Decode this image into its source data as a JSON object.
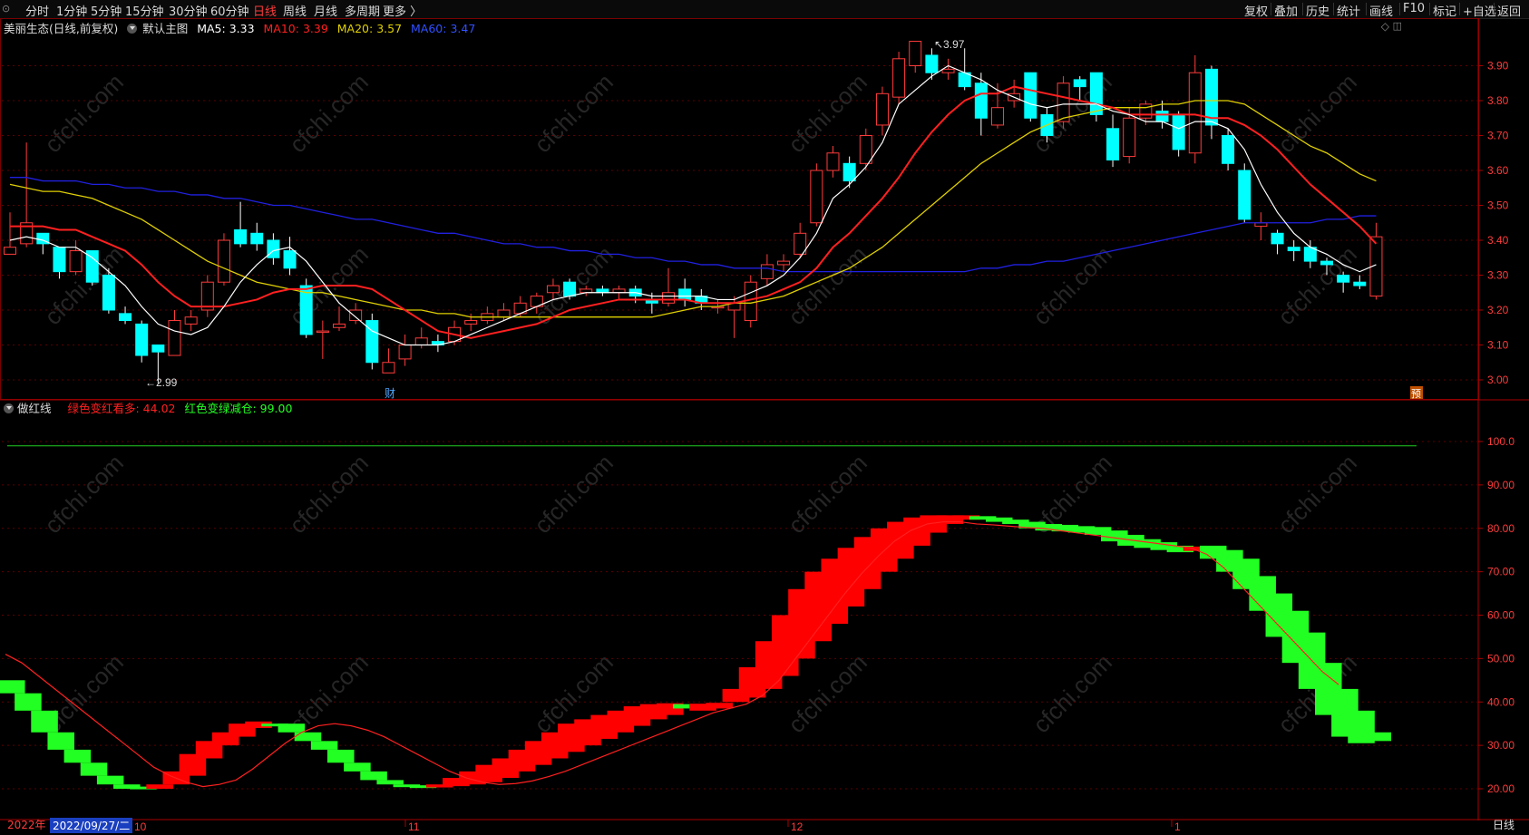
{
  "toolbar": {
    "left": [
      "分时",
      "1分钟",
      "5分钟",
      "15分钟",
      "30分钟",
      "60分钟",
      "日线",
      "周线",
      "月线",
      "多周期",
      "更多 〉"
    ],
    "active": "日线",
    "right": [
      "复权",
      "叠加",
      "历史",
      "统计",
      "画线",
      "F10",
      "标记",
      "+自选",
      "返回"
    ]
  },
  "main": {
    "stock_title": "美丽生态(日线,前复权)",
    "template": "默认主图",
    "ma5": "MA5: 3.33",
    "ma10": "MA10: 3.39",
    "ma20": "MA20: 3.57",
    "ma60": "MA60: 3.47",
    "high_label": "3.97",
    "low_label": "2.99",
    "cai_marker": "财",
    "yu_marker": "预",
    "price_ticks": [
      "3.90",
      "3.80",
      "3.70",
      "3.60",
      "3.50",
      "3.40",
      "3.30",
      "3.20",
      "3.10",
      "3.00"
    ]
  },
  "indicator": {
    "name": "做红线",
    "label1": "绿色变红看多: 44.02",
    "label2": "红色变绿减仓: 99.00",
    "ticks": [
      "100.0",
      "90.00",
      "80.00",
      "70.00",
      "60.00",
      "50.00",
      "40.00",
      "30.00",
      "20.00"
    ]
  },
  "xaxis": {
    "year": "2022年",
    "cursor_date": "2022/09/27/二",
    "months": [
      "10",
      "11",
      "12",
      "1"
    ],
    "period_label": "日线"
  },
  "watermark": "cfchi.com",
  "colors": {
    "up": "#ff3b3b",
    "down": "#00ffff",
    "ma5": "#ffffff",
    "ma10": "#ff2020",
    "ma20": "#e0d000",
    "ma60": "#2020e0",
    "ind_red": "#ff0000",
    "ind_green": "#22ff22"
  },
  "chart_data": {
    "type": "candlestick",
    "candles": [
      [
        3.36,
        3.38,
        3.48,
        3.36
      ],
      [
        3.39,
        3.45,
        3.68,
        3.38
      ],
      [
        3.42,
        3.39,
        3.42,
        3.36
      ],
      [
        3.38,
        3.31,
        3.38,
        3.29
      ],
      [
        3.31,
        3.37,
        3.4,
        3.3
      ],
      [
        3.37,
        3.28,
        3.37,
        3.27
      ],
      [
        3.3,
        3.2,
        3.32,
        3.19
      ],
      [
        3.19,
        3.17,
        3.21,
        3.16
      ],
      [
        3.16,
        3.07,
        3.17,
        3.05
      ],
      [
        3.1,
        3.08,
        3.1,
        2.99
      ],
      [
        3.07,
        3.17,
        3.2,
        3.07
      ],
      [
        3.16,
        3.18,
        3.2,
        3.14
      ],
      [
        3.2,
        3.28,
        3.3,
        3.18
      ],
      [
        3.28,
        3.4,
        3.42,
        3.27
      ],
      [
        3.43,
        3.39,
        3.51,
        3.38
      ],
      [
        3.42,
        3.39,
        3.45,
        3.37
      ],
      [
        3.4,
        3.35,
        3.42,
        3.33
      ],
      [
        3.37,
        3.32,
        3.41,
        3.3
      ],
      [
        3.27,
        3.13,
        3.29,
        3.12
      ],
      [
        3.14,
        3.14,
        3.17,
        3.06
      ],
      [
        3.15,
        3.16,
        3.21,
        3.14
      ],
      [
        3.17,
        3.2,
        3.22,
        3.16
      ],
      [
        3.17,
        3.05,
        3.19,
        3.03
      ],
      [
        3.02,
        3.05,
        3.09,
        3.02
      ],
      [
        3.06,
        3.1,
        3.13,
        3.04
      ],
      [
        3.1,
        3.12,
        3.15,
        3.09
      ],
      [
        3.11,
        3.1,
        3.13,
        3.08
      ],
      [
        3.11,
        3.15,
        3.17,
        3.1
      ],
      [
        3.16,
        3.17,
        3.19,
        3.14
      ],
      [
        3.17,
        3.19,
        3.21,
        3.16
      ],
      [
        3.18,
        3.2,
        3.22,
        3.17
      ],
      [
        3.19,
        3.22,
        3.24,
        3.18
      ],
      [
        3.21,
        3.24,
        3.25,
        3.19
      ],
      [
        3.25,
        3.27,
        3.29,
        3.23
      ],
      [
        3.28,
        3.24,
        3.29,
        3.23
      ],
      [
        3.25,
        3.26,
        3.27,
        3.24
      ],
      [
        3.26,
        3.25,
        3.27,
        3.24
      ],
      [
        3.25,
        3.26,
        3.27,
        3.23
      ],
      [
        3.26,
        3.24,
        3.27,
        3.22
      ],
      [
        3.23,
        3.22,
        3.25,
        3.19
      ],
      [
        3.22,
        3.25,
        3.32,
        3.21
      ],
      [
        3.26,
        3.23,
        3.29,
        3.21
      ],
      [
        3.24,
        3.22,
        3.26,
        3.2
      ],
      [
        3.21,
        3.21,
        3.23,
        3.19
      ],
      [
        3.2,
        3.22,
        3.24,
        3.12
      ],
      [
        3.17,
        3.28,
        3.3,
        3.15
      ],
      [
        3.29,
        3.33,
        3.36,
        3.27
      ],
      [
        3.33,
        3.34,
        3.36,
        3.31
      ],
      [
        3.36,
        3.42,
        3.45,
        3.35
      ],
      [
        3.45,
        3.6,
        3.62,
        3.44
      ],
      [
        3.6,
        3.65,
        3.67,
        3.58
      ],
      [
        3.62,
        3.57,
        3.64,
        3.55
      ],
      [
        3.62,
        3.7,
        3.72,
        3.6
      ],
      [
        3.73,
        3.82,
        3.84,
        3.7
      ],
      [
        3.81,
        3.92,
        3.94,
        3.79
      ],
      [
        3.9,
        3.97,
        3.97,
        3.88
      ],
      [
        3.93,
        3.88,
        3.95,
        3.86
      ],
      [
        3.88,
        3.89,
        3.92,
        3.86
      ],
      [
        3.88,
        3.84,
        3.95,
        3.83
      ],
      [
        3.85,
        3.75,
        3.88,
        3.7
      ],
      [
        3.73,
        3.78,
        3.85,
        3.72
      ],
      [
        3.8,
        3.82,
        3.86,
        3.78
      ],
      [
        3.88,
        3.75,
        3.88,
        3.74
      ],
      [
        3.76,
        3.7,
        3.78,
        3.68
      ],
      [
        3.74,
        3.85,
        3.87,
        3.72
      ],
      [
        3.86,
        3.84,
        3.87,
        3.8
      ],
      [
        3.88,
        3.76,
        3.88,
        3.74
      ],
      [
        3.72,
        3.63,
        3.76,
        3.61
      ],
      [
        3.64,
        3.75,
        3.78,
        3.62
      ],
      [
        3.75,
        3.79,
        3.8,
        3.73
      ],
      [
        3.77,
        3.74,
        3.8,
        3.72
      ],
      [
        3.76,
        3.66,
        3.77,
        3.64
      ],
      [
        3.65,
        3.88,
        3.93,
        3.62
      ],
      [
        3.89,
        3.73,
        3.9,
        3.69
      ],
      [
        3.7,
        3.62,
        3.72,
        3.6
      ],
      [
        3.6,
        3.46,
        3.62,
        3.45
      ],
      [
        3.44,
        3.45,
        3.48,
        3.4
      ],
      [
        3.42,
        3.39,
        3.43,
        3.36
      ],
      [
        3.38,
        3.37,
        3.4,
        3.34
      ],
      [
        3.38,
        3.34,
        3.4,
        3.32
      ],
      [
        3.34,
        3.33,
        3.35,
        3.3
      ],
      [
        3.3,
        3.28,
        3.31,
        3.25
      ],
      [
        3.28,
        3.27,
        3.3,
        3.26
      ],
      [
        3.24,
        3.41,
        3.45,
        3.23
      ]
    ],
    "ma5": [
      3.4,
      3.41,
      3.4,
      3.38,
      3.38,
      3.35,
      3.31,
      3.27,
      3.21,
      3.16,
      3.14,
      3.13,
      3.15,
      3.21,
      3.28,
      3.33,
      3.37,
      3.38,
      3.34,
      3.28,
      3.22,
      3.18,
      3.14,
      3.12,
      3.1,
      3.1,
      3.1,
      3.11,
      3.13,
      3.15,
      3.17,
      3.19,
      3.21,
      3.23,
      3.24,
      3.25,
      3.25,
      3.25,
      3.25,
      3.24,
      3.24,
      3.24,
      3.24,
      3.23,
      3.23,
      3.25,
      3.27,
      3.3,
      3.35,
      3.42,
      3.52,
      3.56,
      3.61,
      3.68,
      3.79,
      3.83,
      3.87,
      3.9,
      3.88,
      3.86,
      3.83,
      3.81,
      3.79,
      3.78,
      3.79,
      3.79,
      3.79,
      3.77,
      3.76,
      3.74,
      3.74,
      3.72,
      3.74,
      3.74,
      3.72,
      3.66,
      3.56,
      3.48,
      3.42,
      3.38,
      3.36,
      3.33,
      3.31,
      3.33
    ],
    "ma10": [
      3.44,
      3.44,
      3.44,
      3.43,
      3.43,
      3.41,
      3.39,
      3.37,
      3.33,
      3.28,
      3.24,
      3.21,
      3.21,
      3.21,
      3.22,
      3.23,
      3.25,
      3.26,
      3.26,
      3.27,
      3.27,
      3.27,
      3.26,
      3.23,
      3.2,
      3.17,
      3.14,
      3.13,
      3.12,
      3.13,
      3.14,
      3.15,
      3.16,
      3.18,
      3.2,
      3.21,
      3.22,
      3.23,
      3.23,
      3.23,
      3.23,
      3.23,
      3.22,
      3.22,
      3.22,
      3.23,
      3.24,
      3.26,
      3.28,
      3.32,
      3.38,
      3.42,
      3.47,
      3.52,
      3.58,
      3.65,
      3.71,
      3.76,
      3.8,
      3.82,
      3.82,
      3.84,
      3.83,
      3.82,
      3.81,
      3.8,
      3.79,
      3.78,
      3.76,
      3.76,
      3.76,
      3.76,
      3.76,
      3.75,
      3.75,
      3.73,
      3.7,
      3.66,
      3.61,
      3.56,
      3.52,
      3.48,
      3.44,
      3.39
    ],
    "ma20": [
      3.56,
      3.55,
      3.54,
      3.54,
      3.53,
      3.52,
      3.5,
      3.48,
      3.46,
      3.43,
      3.4,
      3.37,
      3.34,
      3.32,
      3.3,
      3.28,
      3.27,
      3.26,
      3.25,
      3.25,
      3.24,
      3.23,
      3.22,
      3.21,
      3.2,
      3.2,
      3.19,
      3.19,
      3.18,
      3.18,
      3.18,
      3.18,
      3.18,
      3.18,
      3.18,
      3.18,
      3.18,
      3.18,
      3.18,
      3.18,
      3.19,
      3.2,
      3.21,
      3.21,
      3.22,
      3.22,
      3.23,
      3.24,
      3.26,
      3.28,
      3.3,
      3.32,
      3.35,
      3.38,
      3.42,
      3.46,
      3.5,
      3.54,
      3.58,
      3.62,
      3.65,
      3.68,
      3.71,
      3.73,
      3.75,
      3.76,
      3.77,
      3.78,
      3.78,
      3.78,
      3.79,
      3.79,
      3.8,
      3.8,
      3.8,
      3.79,
      3.76,
      3.73,
      3.7,
      3.67,
      3.65,
      3.62,
      3.59,
      3.57
    ],
    "ma60": [
      3.58,
      3.58,
      3.57,
      3.57,
      3.57,
      3.56,
      3.56,
      3.55,
      3.55,
      3.54,
      3.54,
      3.53,
      3.53,
      3.52,
      3.52,
      3.51,
      3.5,
      3.5,
      3.49,
      3.48,
      3.47,
      3.46,
      3.46,
      3.45,
      3.44,
      3.43,
      3.42,
      3.42,
      3.41,
      3.4,
      3.39,
      3.39,
      3.38,
      3.38,
      3.37,
      3.37,
      3.36,
      3.36,
      3.35,
      3.35,
      3.34,
      3.34,
      3.33,
      3.33,
      3.32,
      3.32,
      3.32,
      3.31,
      3.31,
      3.31,
      3.31,
      3.31,
      3.31,
      3.31,
      3.31,
      3.31,
      3.31,
      3.31,
      3.31,
      3.32,
      3.32,
      3.33,
      3.33,
      3.34,
      3.34,
      3.35,
      3.36,
      3.37,
      3.38,
      3.39,
      3.4,
      3.41,
      3.42,
      3.43,
      3.44,
      3.45,
      3.45,
      3.45,
      3.45,
      3.45,
      3.46,
      3.46,
      3.47,
      3.47
    ],
    "indicator_steps": [
      [
        45,
        42,
        "g"
      ],
      [
        42,
        38,
        "g"
      ],
      [
        38,
        33,
        "g"
      ],
      [
        33,
        29,
        "g"
      ],
      [
        29,
        26,
        "g"
      ],
      [
        26,
        23,
        "g"
      ],
      [
        23,
        21,
        "g"
      ],
      [
        21,
        20,
        "g"
      ],
      [
        20,
        20.5,
        "g"
      ],
      [
        20,
        21,
        "r"
      ],
      [
        21,
        24,
        "r"
      ],
      [
        23,
        28,
        "r"
      ],
      [
        27,
        31,
        "r"
      ],
      [
        30,
        33,
        "r"
      ],
      [
        32,
        35,
        "r"
      ],
      [
        34,
        35.5,
        "r"
      ],
      [
        34.5,
        35,
        "g"
      ],
      [
        33,
        35,
        "g"
      ],
      [
        31,
        33,
        "g"
      ],
      [
        29,
        31,
        "g"
      ],
      [
        26,
        29,
        "g"
      ],
      [
        24,
        26,
        "g"
      ],
      [
        22,
        24,
        "g"
      ],
      [
        21,
        22,
        "g"
      ],
      [
        20.5,
        21,
        "g"
      ],
      [
        20.3,
        20.8,
        "g"
      ],
      [
        20.3,
        21,
        "r"
      ],
      [
        20.6,
        22.5,
        "r"
      ],
      [
        21,
        24,
        "r"
      ],
      [
        21.5,
        25.5,
        "r"
      ],
      [
        22.5,
        27,
        "r"
      ],
      [
        24,
        29,
        "r"
      ],
      [
        25.5,
        31,
        "r"
      ],
      [
        27,
        33,
        "r"
      ],
      [
        28.5,
        35,
        "r"
      ],
      [
        30,
        36,
        "r"
      ],
      [
        31.5,
        37,
        "r"
      ],
      [
        33,
        38,
        "r"
      ],
      [
        34.5,
        39,
        "r"
      ],
      [
        36,
        39.5,
        "r"
      ],
      [
        37,
        39.7,
        "r"
      ],
      [
        38.5,
        39.5,
        "g"
      ],
      [
        38,
        39.6,
        "r"
      ],
      [
        38.5,
        39.8,
        "r"
      ],
      [
        40,
        43,
        "r"
      ],
      [
        41,
        48,
        "r"
      ],
      [
        43,
        54,
        "r"
      ],
      [
        46,
        60,
        "r"
      ],
      [
        50,
        66,
        "r"
      ],
      [
        54,
        70,
        "r"
      ],
      [
        58,
        73,
        "r"
      ],
      [
        62,
        75.5,
        "r"
      ],
      [
        66,
        78,
        "r"
      ],
      [
        70,
        80,
        "r"
      ],
      [
        73,
        81.5,
        "r"
      ],
      [
        76,
        82.5,
        "r"
      ],
      [
        79,
        83,
        "r"
      ],
      [
        81,
        83,
        "r"
      ],
      [
        82,
        83,
        "r"
      ],
      [
        82,
        82.8,
        "g"
      ],
      [
        81.5,
        82.5,
        "g"
      ],
      [
        81,
        82,
        "g"
      ],
      [
        80,
        81.5,
        "g"
      ],
      [
        79.5,
        81,
        "g"
      ],
      [
        79.3,
        80.8,
        "g"
      ],
      [
        79,
        80.5,
        "g"
      ],
      [
        78.5,
        80.3,
        "g"
      ],
      [
        77,
        79.5,
        "g"
      ],
      [
        76,
        78.5,
        "g"
      ],
      [
        75.5,
        77.5,
        "g"
      ],
      [
        75,
        76.8,
        "g"
      ],
      [
        74.5,
        76,
        "g"
      ],
      [
        74.8,
        75.8,
        "r"
      ],
      [
        73,
        76,
        "g"
      ],
      [
        70,
        75,
        "g"
      ],
      [
        66,
        73,
        "g"
      ],
      [
        61,
        69,
        "g"
      ],
      [
        55,
        65,
        "g"
      ],
      [
        49,
        61,
        "g"
      ],
      [
        43,
        56,
        "g"
      ],
      [
        37,
        49,
        "g"
      ],
      [
        32,
        43,
        "g"
      ],
      [
        30.5,
        38,
        "g"
      ],
      [
        31,
        33,
        "g"
      ]
    ],
    "indicator_line": [
      51,
      49,
      46,
      43,
      40,
      37,
      34,
      31,
      28,
      25,
      23,
      21.5,
      20.5,
      21,
      22,
      24.5,
      27.5,
      30.5,
      33,
      34.5,
      35,
      34.5,
      33.5,
      32,
      30,
      28,
      26,
      24,
      22.5,
      21.5,
      21,
      21.2,
      21.8,
      22.8,
      24,
      25.5,
      27,
      28.5,
      30,
      31.5,
      33,
      34.5,
      36,
      37.5,
      38.5,
      39.5,
      41.5,
      45,
      50,
      55,
      60,
      65,
      69.5,
      73.5,
      77,
      79.5,
      81,
      81.5,
      81.5,
      81,
      80.8,
      80.5,
      80.2,
      80,
      79.5,
      79,
      78.5,
      78,
      77.5,
      77,
      76.5,
      76,
      75.5,
      74,
      71,
      67,
      63,
      59,
      55,
      51,
      47,
      44
    ]
  }
}
